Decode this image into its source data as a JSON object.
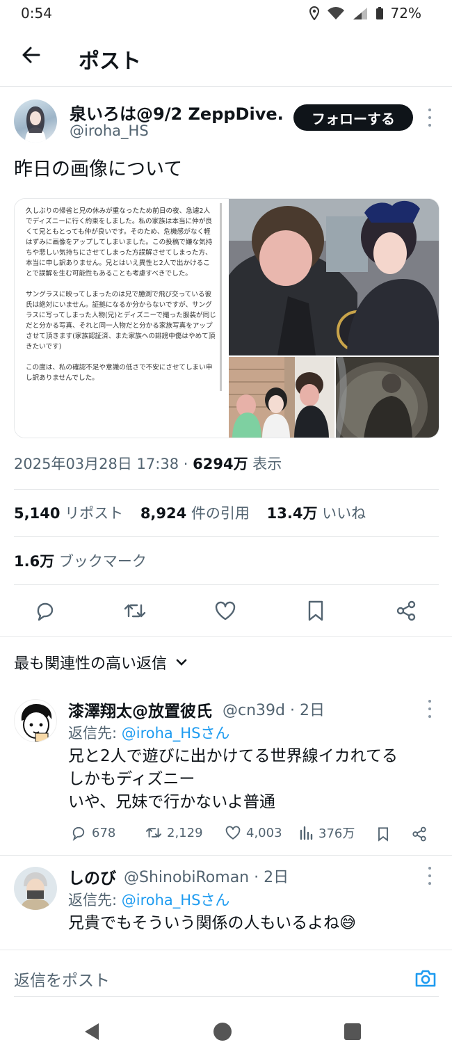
{
  "status_bar": {
    "time": "0:54",
    "battery": "72%"
  },
  "header": {
    "title": "ポスト"
  },
  "post": {
    "author_name": "泉いろは@9/2 ZeppDive...",
    "author_handle": "@iroha_HS",
    "follow_label": "フォローする",
    "text": "昨日の画像について",
    "image_doc": {
      "p1": "久しぶりの帰省と兄の休みが重なったため前日の夜、急遽2人でディズニーに行く約束をしました。私の家族は本当に仲が良くて兄ともとっても仲が良いです。そのため、危機感がなく軽はずみに画像をアップしてしまいました。この投稿で嫌な気持ちや悲しい気持ちにさせてしまった方誤解させてしまった方、本当に申し訳ありません。兄とはいえ異性と2人で出かけることで誤解を生む可能性もあることも考慮すべきでした。",
      "p2": "サングラスに映ってしまったのは兄で臆測で飛び交っている彼氏は絶対にいません。証拠になるか分からないですが、サングラスに写ってしまった人物(兄)とディズニーで撮った服装が同じだと分かる写真、それと同一人物だと分かる家族写真をアップさせて頂きます(家族認証済、また家族への誹謗中傷はやめて頂きたいです)",
      "p3": "この度は、私の確認不足や意識の低さで不安にさせてしまい申し訳ありませんでした。"
    },
    "date": "2025年03月28日 17:38",
    "dot": "·",
    "views_count": "6294万",
    "views_label": "表示",
    "reposts_count": "5,140",
    "reposts_label": "リポスト",
    "quotes_count": "8,924",
    "quotes_label": "件の引用",
    "likes_count": "13.4万",
    "likes_label": "いいね",
    "bookmarks_count": "1.6万",
    "bookmarks_label": "ブックマーク"
  },
  "sort": {
    "label": "最も関連性の高い返信"
  },
  "replies": [
    {
      "name": "漆澤翔太@放置彼氏",
      "handle_time": "@cn39d · 2日",
      "reply_to_prefix": "返信先:",
      "reply_to": "@iroha_HSさん",
      "text": "兄と2人で遊びに出かけてる世界線イカれてる\nしかもディズニー\nいや、兄妹で行かないよ普通",
      "replies": "678",
      "reposts": "2,129",
      "likes": "4,003",
      "views": "376万"
    },
    {
      "name": "しのび",
      "handle_time": "@ShinobiRoman · 2日",
      "reply_to_prefix": "返信先:",
      "reply_to": "@iroha_HSさん",
      "text": "兄貴でもそういう関係の人もいるよね😅"
    }
  ],
  "composer": {
    "placeholder": "返信をポスト"
  },
  "colors": {
    "accent": "#1d9bf0",
    "text": "#0f1419",
    "muted": "#536471"
  }
}
